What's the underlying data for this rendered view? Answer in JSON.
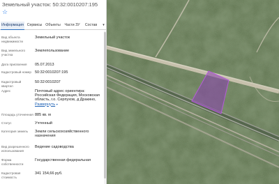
{
  "title": "Земельный участок: 50:32:0010207:195",
  "star_icon": "star-outline-icon",
  "tabs": [
    {
      "label": "Информация",
      "active": true
    },
    {
      "label": "Сервисы",
      "active": false
    },
    {
      "label": "Объекты",
      "active": false
    },
    {
      "label": "Части ЗУ",
      "active": false
    },
    {
      "label": "Состав",
      "active": false
    }
  ],
  "tabs_more_icon": "chevron-down-icon",
  "fields": [
    {
      "label": "Вид объекта недвижимости",
      "value": "Земельный участок"
    },
    {
      "label": "Вид земельного участка",
      "value": "Землепользование"
    },
    {
      "label": "Дата присвоения",
      "value": "05.07.2013"
    },
    {
      "label": "Кадастровый номер",
      "value": "50:32:0010207:195"
    },
    {
      "label": "Кадастровый квартал",
      "value": "50:32:0010207"
    },
    {
      "label": "Адрес",
      "value": "Почтовый адрес ориентира: Российская Федерация, Московская область, г.о. Серпухов, д Дракино,",
      "link": "Развернуть"
    },
    {
      "label": "Площадь уточненная",
      "value": "885 кв. м"
    },
    {
      "label": "Статус",
      "value": "Учтенный"
    },
    {
      "label": "Категория земель",
      "value": "Земли сельскохозяйственного назначения"
    },
    {
      "label": "Вид разрешенного использования",
      "value": "Ведение садоводства"
    },
    {
      "label": "Форма собственности",
      "value": "Государственная федеральная"
    },
    {
      "label": "Кадастровая стоимость",
      "value": "341 154,66 руб."
    }
  ],
  "colors": {
    "accent": "#1a5fb4",
    "parcel_fill": "#8a3fb0",
    "parcel_stroke": "#b45cd8",
    "map_base": "#5b6f4a"
  }
}
